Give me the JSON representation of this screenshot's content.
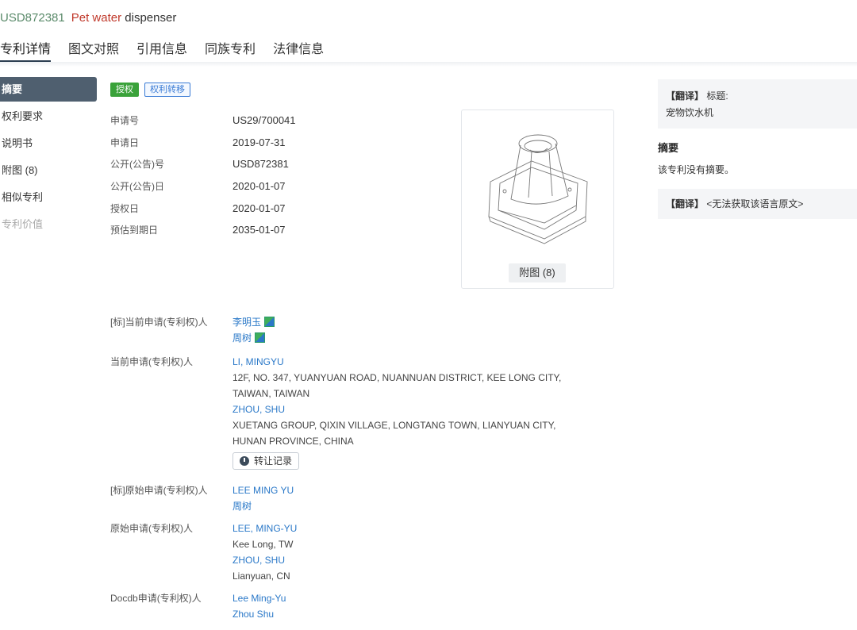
{
  "header": {
    "patent_number": "USD872381",
    "title_en_colored": "Pet water",
    "title_en_rest": " dispenser"
  },
  "tabs": [
    {
      "label": "专利详情",
      "active": true
    },
    {
      "label": "图文对照"
    },
    {
      "label": "引用信息"
    },
    {
      "label": "同族专利"
    },
    {
      "label": "法律信息"
    }
  ],
  "sidebar": {
    "items": [
      {
        "label": "摘要",
        "active": true
      },
      {
        "label": "权利要求"
      },
      {
        "label": "说明书"
      },
      {
        "label": "附图 (8)"
      },
      {
        "label": "相似专利"
      },
      {
        "label": "专利价值",
        "disabled": true
      }
    ]
  },
  "badges": {
    "status": "授权",
    "transfer": "权利转移"
  },
  "info_rows": [
    {
      "label": "申请号",
      "value": "US29/700041"
    },
    {
      "label": "申请日",
      "value": "2019-07-31"
    },
    {
      "label": "公开(公告)号",
      "value": "USD872381"
    },
    {
      "label": "公开(公告)日",
      "value": "2020-01-07"
    },
    {
      "label": "授权日",
      "value": "2020-01-07"
    },
    {
      "label": "预估到期日",
      "value": "2035-01-07"
    }
  ],
  "figure": {
    "button_label": "附图 (8)"
  },
  "people": {
    "std_current_label": "[标]当前申请(专利权)人",
    "std_current": [
      "李明玉",
      "周树"
    ],
    "current_label": "当前申请(专利权)人",
    "current": [
      {
        "name": "LI, MINGYU",
        "addr1": "12F, NO. 347, YUANYUAN ROAD, NUANNUAN DISTRICT, KEE LONG CITY,",
        "addr2": "TAIWAN, TAIWAN"
      },
      {
        "name": "ZHOU, SHU",
        "addr1": "XUETANG GROUP, QIXIN VILLAGE, LONGTANG TOWN, LIANYUAN CITY,",
        "addr2": "HUNAN PROVINCE, CHINA"
      }
    ],
    "transfer_button": "转让记录",
    "std_original_label": "[标]原始申请(专利权)人",
    "std_original": [
      "LEE MING YU",
      "周树"
    ],
    "original_label": "原始申请(专利权)人",
    "original": [
      {
        "name": "LEE, MING-YU",
        "loc": "Kee Long, TW"
      },
      {
        "name": "ZHOU, SHU",
        "loc": "Lianyuan, CN"
      }
    ],
    "docdb_label": "Docdb申请(专利权)人",
    "docdb": [
      "Lee Ming-Yu",
      "Zhou Shu"
    ]
  },
  "right": {
    "trans_tag": "【翻译】",
    "trans_title_label": "标题:",
    "trans_title": "宠物饮水机",
    "abstract_heading": "摘要",
    "abstract_text": "该专利没有摘要。",
    "trans_tag2": "【翻译】",
    "trans_unavailable": "<无法获取该语言原文>"
  }
}
